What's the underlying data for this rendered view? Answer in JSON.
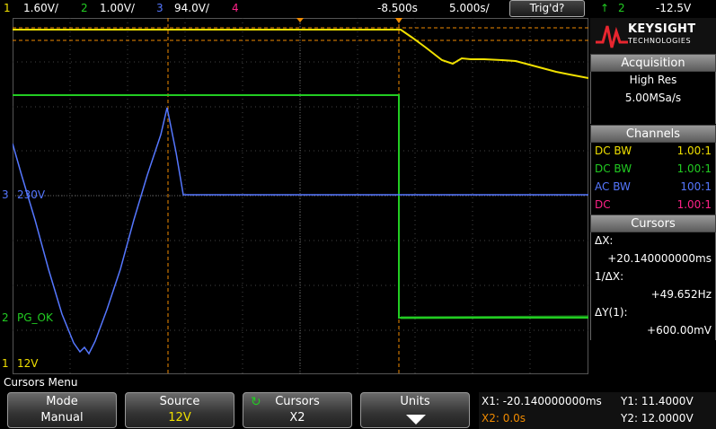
{
  "topbar": {
    "ch1_num": "1",
    "ch1_scale": "1.60V/",
    "ch2_num": "2",
    "ch2_scale": "1.00V/",
    "ch3_num": "3",
    "ch3_scale": "94.0V/",
    "ch4_num": "4",
    "time_offset": "-8.500s",
    "time_scale": "5.000s/",
    "trigger_status": "Trig'd?",
    "trig_channel": "2",
    "trig_level": "-12.5V"
  },
  "screen": {
    "ch3_label": "230V",
    "ch3_marker": "3",
    "ch2_label": "PG_OK",
    "ch2_marker": "2",
    "ch1_label": "12V",
    "ch1_marker": "1"
  },
  "brand": {
    "name": "KEYSIGHT",
    "sub": "TECHNOLOGIES"
  },
  "acquisition": {
    "title": "Acquisition",
    "mode": "High Res",
    "rate": "5.00MSa/s"
  },
  "channels": {
    "title": "Channels",
    "rows": [
      {
        "coupling": "DC BW",
        "ratio": "1.00:1"
      },
      {
        "coupling": "DC BW",
        "ratio": "1.00:1"
      },
      {
        "coupling": "AC BW",
        "ratio": "100:1"
      },
      {
        "coupling": "DC",
        "ratio": "1.00:1"
      }
    ]
  },
  "cursors_panel": {
    "title": "Cursors",
    "dx_label": "ΔX:",
    "dx_value": "+20.140000000ms",
    "inv_label": "1/ΔX:",
    "inv_value": "+49.652Hz",
    "dy_label": "ΔY(1):",
    "dy_value": "+600.00mV"
  },
  "menu": {
    "title": "Cursors Menu",
    "keys": [
      {
        "top": "Mode",
        "bottom": "Manual"
      },
      {
        "top": "Source",
        "bottom": "12V"
      },
      {
        "top": "Cursors",
        "bottom": "X2"
      },
      {
        "top": "Units",
        "bottom": ""
      }
    ]
  },
  "readout": {
    "x1": "X1: -20.140000000ms",
    "y1": "Y1: 11.4000V",
    "x2": "X2: 0.0s",
    "y2": "Y2: 12.0000V"
  },
  "colors": {
    "ch1": "#f0e000",
    "ch2": "#22cc22",
    "ch3": "#5577ff",
    "ch4": "#ff2288",
    "cursor": "#f08a00"
  }
}
